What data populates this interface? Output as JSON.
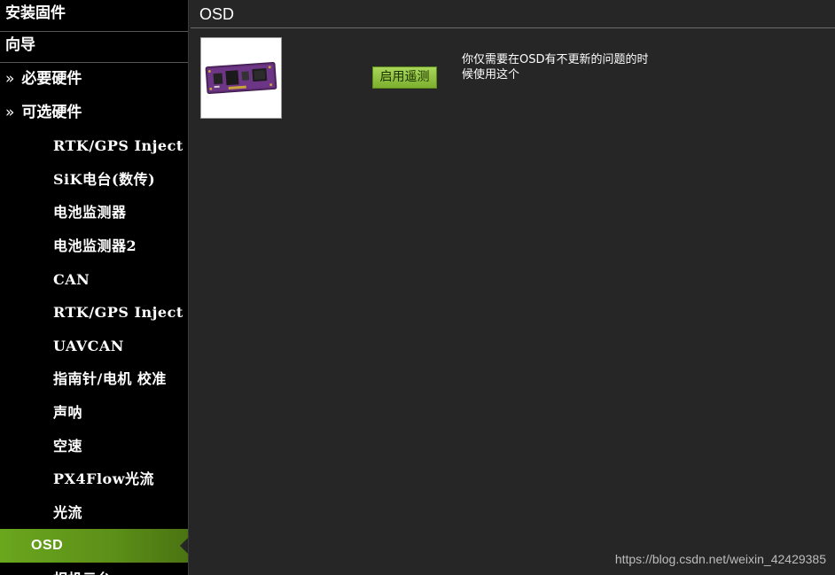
{
  "sidebar": {
    "headers": [
      "安装固件",
      "向导"
    ],
    "items": [
      {
        "label": "必要硬件",
        "arrow": "»",
        "level": 0
      },
      {
        "label": "可选硬件",
        "arrow": "»",
        "level": 0
      },
      {
        "label": "RTK/GPS Inject",
        "level": 1
      },
      {
        "label": "SiK电台(数传)",
        "level": 1
      },
      {
        "label": "电池监测器",
        "level": 1
      },
      {
        "label": "电池监测器2",
        "level": 1
      },
      {
        "label": "CAN",
        "level": 1
      },
      {
        "label": "RTK/GPS Inject",
        "level": 1
      },
      {
        "label": "UAVCAN",
        "level": 1
      },
      {
        "label": "指南针/电机 校准",
        "level": 1
      },
      {
        "label": "声呐",
        "level": 1
      },
      {
        "label": "空速",
        "level": 1
      },
      {
        "label": "PX4Flow光流",
        "level": 1
      },
      {
        "label": "光流",
        "level": 1
      },
      {
        "label": "OSD",
        "level": 1,
        "active": true
      },
      {
        "label": "相机云台",
        "level": 1
      }
    ]
  },
  "main": {
    "title": "OSD",
    "enable_button": "启用遥测",
    "description": "你仅需要在OSD有不更新的问题的时候使用这个"
  },
  "watermark": "https://blog.csdn.net/weixin_42429385",
  "colors": {
    "accent_green": "#7cb02d",
    "background": "#262626",
    "sidebar_bg": "#000000"
  }
}
